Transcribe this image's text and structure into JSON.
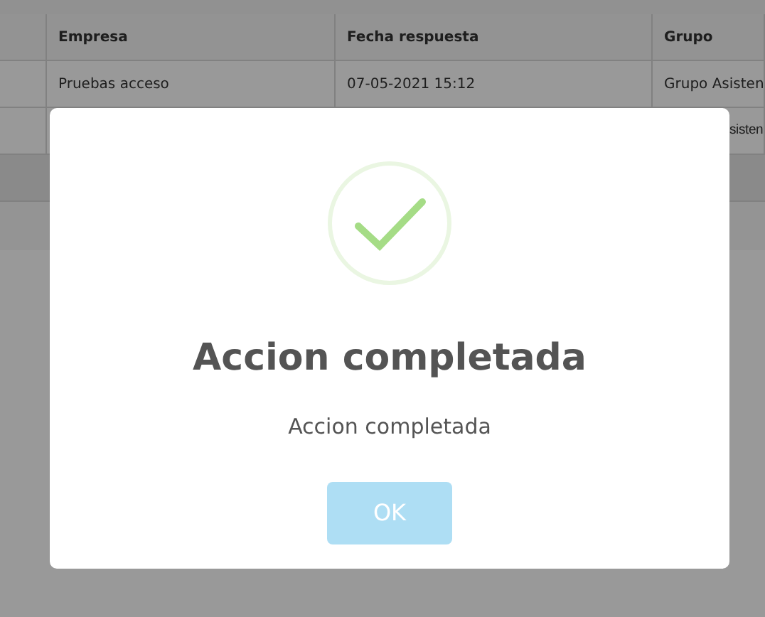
{
  "table": {
    "columns": [
      "",
      "Empresa",
      "Fecha respuesta",
      "Grupo"
    ],
    "rows": [
      [
        "",
        "Pruebas acceso",
        "07-05-2021 15:12",
        "Grupo Asisten"
      ],
      [
        "",
        "",
        "",
        "sisten"
      ]
    ]
  },
  "dialog": {
    "title": "Accion completada",
    "message": "Accion completada",
    "button": "OK"
  }
}
